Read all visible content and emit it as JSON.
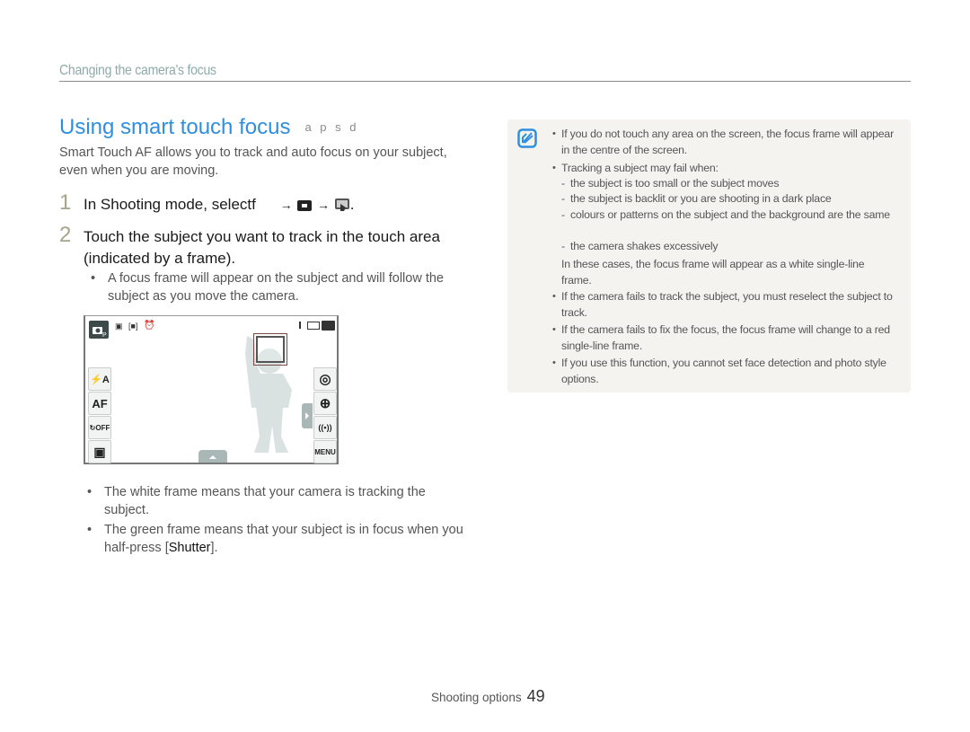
{
  "section_header": "Changing the camera's focus",
  "title": "Using smart touch focus",
  "mode_icons": "a p s d",
  "intro": "Smart Touch AF allows you to track and auto focus on your subject, even when you are moving.",
  "steps": [
    {
      "num": "1",
      "text": "In Shooting mode, selectf",
      "arrow": "→"
    },
    {
      "num": "2",
      "text": "Touch the subject you want to track in the touch area (indicated by a frame)."
    }
  ],
  "step2_bullet": "A focus frame will appear on the subject and will follow the subject as you move the camera.",
  "camera_screen": {
    "mode_icon": "camera-program-icon",
    "status_icons": [
      "size-icon",
      "metering-icon",
      "timer-icon"
    ],
    "right_status": [
      "single-shot-indicator",
      "memory-icon",
      "battery-icon"
    ],
    "left_buttons": [
      {
        "icon": "flash-auto-icon",
        "label": "⚡A"
      },
      {
        "icon": "af-icon",
        "label": "AF"
      },
      {
        "icon": "timer-off-icon",
        "label": "↻OFF"
      },
      {
        "icon": "display-icon",
        "label": "▣"
      }
    ],
    "right_buttons": [
      {
        "icon": "stabilizer-icon",
        "label": "◎"
      },
      {
        "icon": "focus-area-icon",
        "label": "⊕"
      },
      {
        "icon": "wireless-icon",
        "label": "((•))"
      },
      {
        "icon": "menu-icon",
        "label": "MENU"
      }
    ]
  },
  "bullets": [
    {
      "text": "The white frame means that your camera is tracking the subject."
    },
    {
      "text_before": "The green frame means that your subject is in focus when you half-press [",
      "bold": "Shutter",
      "text_after": "]."
    }
  ],
  "note": {
    "icon": "note-icon",
    "items": [
      {
        "text": "If you do not touch any area on the screen, the focus frame will appear in the centre of the screen."
      },
      {
        "text": "Tracking a subject may fail when:",
        "sub": [
          "the subject is too small or the subject moves",
          "the subject is backlit or you are shooting in a dark place",
          "colours or patterns on the subject and the background are the same",
          "the camera shakes excessively"
        ],
        "after": "In these cases, the focus frame will appear as a white single-line frame."
      },
      {
        "text": "If the camera fails to track the subject, you must reselect the subject to track."
      },
      {
        "text": "If the camera fails to fix the focus, the focus frame will change to a red single-line frame."
      },
      {
        "text": "If you use this function, you cannot set face detection and photo style options."
      }
    ]
  },
  "footer": {
    "section": "Shooting options",
    "page": "49"
  },
  "colors": {
    "title": "#2e8fe0",
    "header": "#8eaaa8",
    "step_num": "#a6a489",
    "note_bg": "#f5f3ef"
  }
}
